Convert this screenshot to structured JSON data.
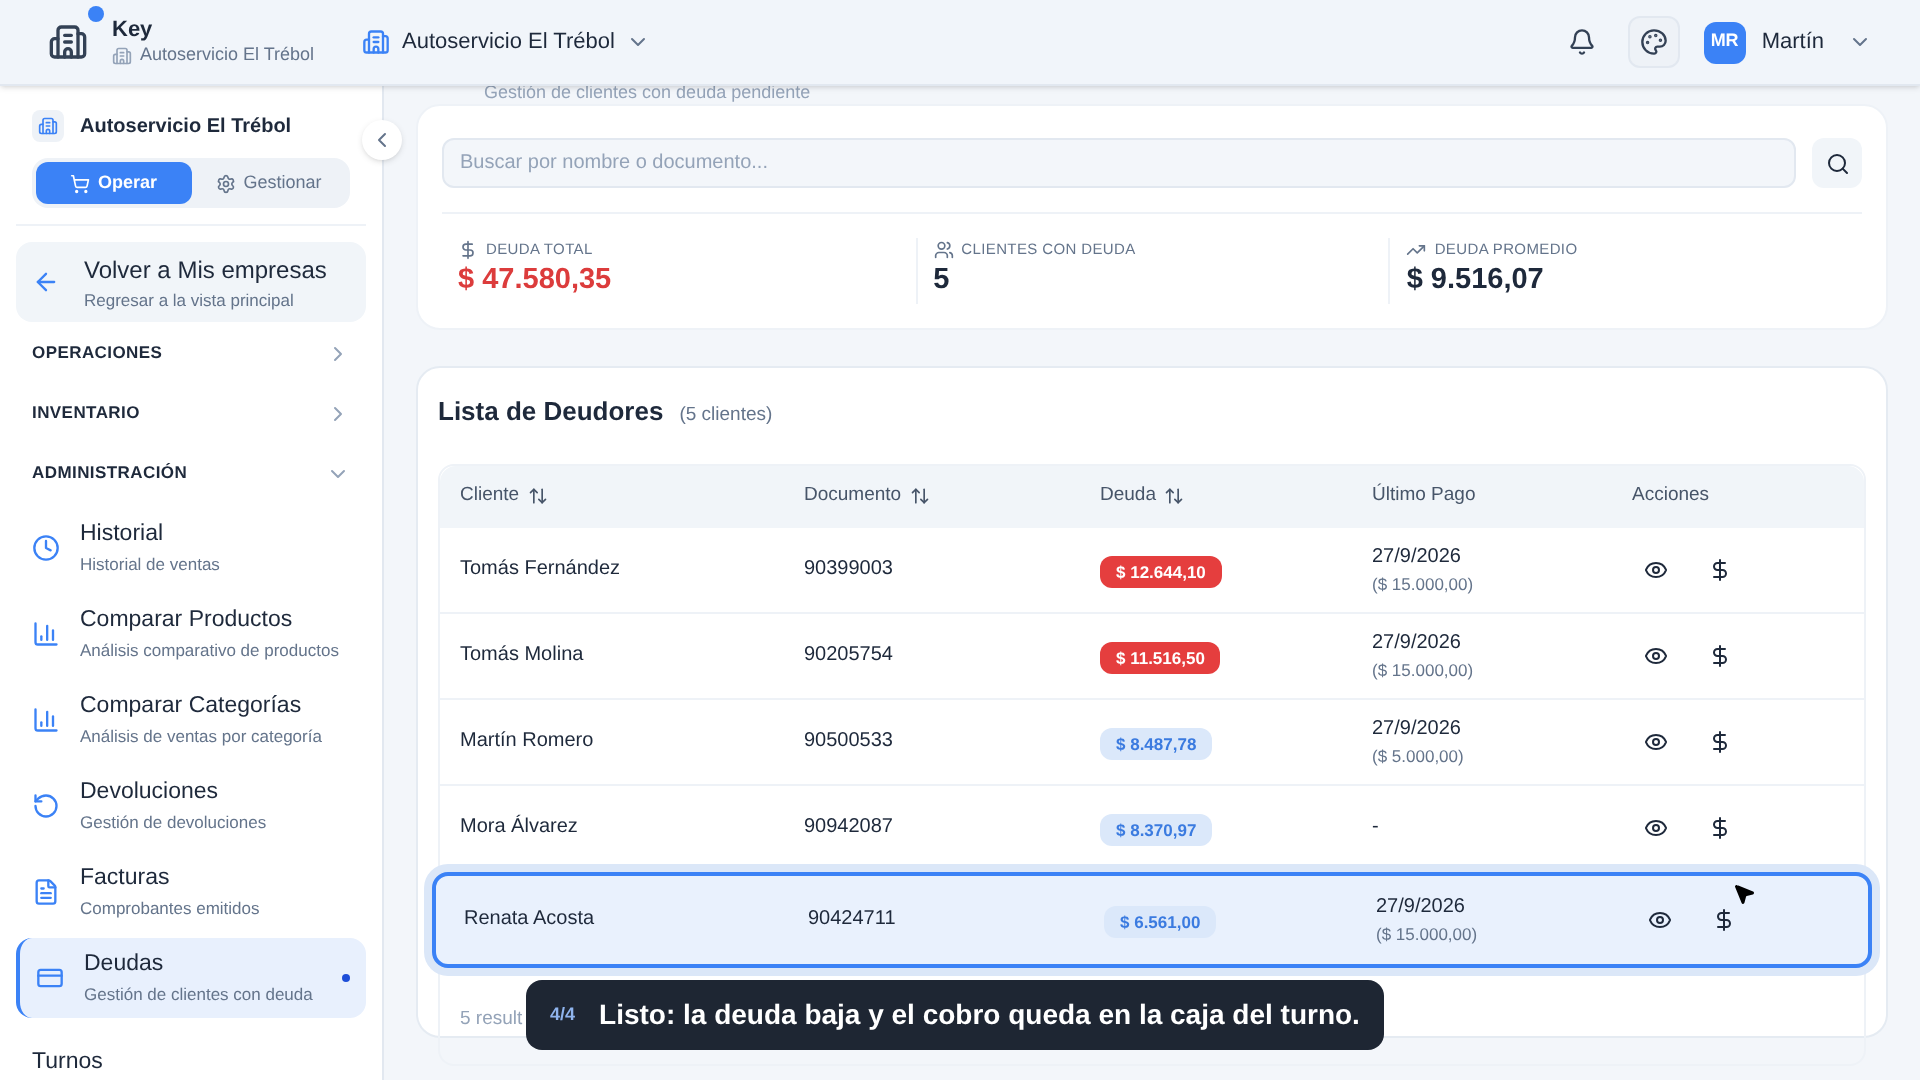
{
  "header": {
    "app_name": "Key",
    "app_subtitle": "Autoservicio El Trébol",
    "company_selector": "Autoservicio El Trébol",
    "user_initials": "MR",
    "user_name": "Martín",
    "notification_dot": true
  },
  "sidebar": {
    "company": "Autoservicio El Trébol",
    "mode_tabs": [
      {
        "label": "Operar",
        "selected": true
      },
      {
        "label": "Gestionar",
        "selected": false
      }
    ],
    "back": {
      "title": "Volver a Mis empresas",
      "subtitle": "Regresar a la vista principal"
    },
    "sections": [
      {
        "label": "OPERACIONES",
        "expanded": false
      },
      {
        "label": "INVENTARIO",
        "expanded": false
      },
      {
        "label": "ADMINISTRACIÓN",
        "expanded": true,
        "items": [
          {
            "kind": "clock",
            "title": "Historial",
            "subtitle": "Historial de ventas",
            "selected": false
          },
          {
            "kind": "chart",
            "title": "Comparar Productos",
            "subtitle": "Análisis comparativo de productos",
            "selected": false
          },
          {
            "kind": "chart",
            "title": "Comparar Categorías",
            "subtitle": "Análisis de ventas por categoría",
            "selected": false
          },
          {
            "kind": "undo",
            "title": "Devoluciones",
            "subtitle": "Gestión de devoluciones",
            "selected": false
          },
          {
            "kind": "file",
            "title": "Facturas",
            "subtitle": "Comprobantes emitidos",
            "selected": false
          },
          {
            "kind": "card",
            "title": "Deudas",
            "subtitle": "Gestión de clientes con deuda",
            "selected": true
          },
          {
            "kind": "none",
            "title": "Turnos",
            "selected": false
          }
        ]
      }
    ]
  },
  "page_subtitle": "Gestión de clientes con deuda pendiente",
  "search": {
    "placeholder": "Buscar por nombre o documento..."
  },
  "stats": [
    {
      "kind": "dollar",
      "label": "DEUDA TOTAL",
      "value": "$ 47.580,35",
      "alert": true
    },
    {
      "kind": "users",
      "label": "CLIENTES CON DEUDA",
      "value": "5",
      "alert": false
    },
    {
      "kind": "trend",
      "label": "DEUDA PROMEDIO",
      "value": "$ 9.516,07",
      "alert": false
    }
  ],
  "list": {
    "title": "Lista de Deudores",
    "count": "(5 clientes)",
    "columns": [
      {
        "label": "Cliente",
        "sortable": true
      },
      {
        "label": "Documento",
        "sortable": true
      },
      {
        "label": "Deuda",
        "sortable": true
      },
      {
        "label": "Último Pago",
        "sortable": false
      },
      {
        "label": "Acciones",
        "sortable": false
      }
    ],
    "rows": [
      {
        "client": "Tomás Fernández",
        "document": "90399003",
        "debt": "$ 12.644,10",
        "high": true,
        "last_payment": "27/9/2026",
        "last_amount": "($ 15.000,00)",
        "selected": false
      },
      {
        "client": "Tomás Molina",
        "document": "90205754",
        "debt": "$ 11.516,50",
        "high": true,
        "last_payment": "27/9/2026",
        "last_amount": "($ 15.000,00)",
        "selected": false
      },
      {
        "client": "Martín Romero",
        "document": "90500533",
        "debt": "$ 8.487,78",
        "high": false,
        "last_payment": "27/9/2026",
        "last_amount": "($ 5.000,00)",
        "selected": false
      },
      {
        "client": "Mora Álvarez",
        "document": "90942087",
        "debt": "$ 8.370,97",
        "high": false,
        "last_payment": "-",
        "selected": false
      },
      {
        "client": "Renata Acosta",
        "document": "90424711",
        "debt": "$ 6.561,00",
        "high": false,
        "last_payment": "27/9/2026",
        "last_amount": "($ 15.000,00)",
        "selected": true
      }
    ],
    "footer": "5 result"
  },
  "tour_tip": {
    "step": "4/4",
    "text": "Listo: la deuda baja y el cobro queda en la caja del turno."
  }
}
